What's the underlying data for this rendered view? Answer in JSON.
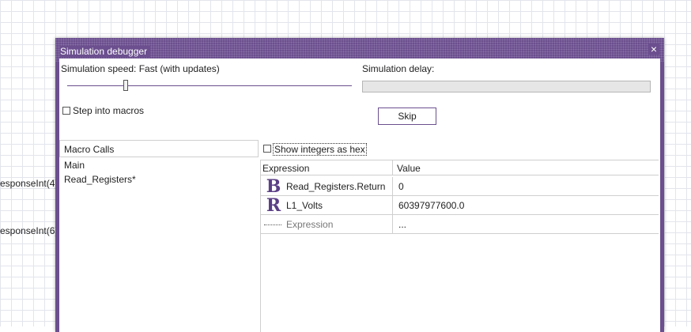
{
  "background": {
    "labels": [
      "esponseInt(4)",
      "esponseInt(6)"
    ]
  },
  "window": {
    "title": "Simulation debugger",
    "close_label": "×",
    "speed_label": "Simulation speed: Fast (with updates)",
    "delay_label": "Simulation delay:",
    "step_into_macros_label": "Step into macros",
    "skip_label": "Skip",
    "show_hex_label": "Show integers as hex"
  },
  "macro_panel": {
    "header": "Macro Calls",
    "items": [
      "Main",
      "Read_Registers*"
    ]
  },
  "watch_grid": {
    "headers": {
      "expression": "Expression",
      "value": "Value"
    },
    "rows": [
      {
        "icon": "B",
        "icon_name": "boolean-type-icon",
        "expression": "Read_Registers.Return",
        "value": "0"
      },
      {
        "icon": "R",
        "icon_name": "real-type-icon",
        "expression": "L1_Volts",
        "value": "60397977600.0"
      }
    ],
    "new_row": {
      "expression": "Expression",
      "value": "..."
    }
  },
  "colors": {
    "accent": "#6b4f8e",
    "grid_line": "#e3e5ec"
  }
}
